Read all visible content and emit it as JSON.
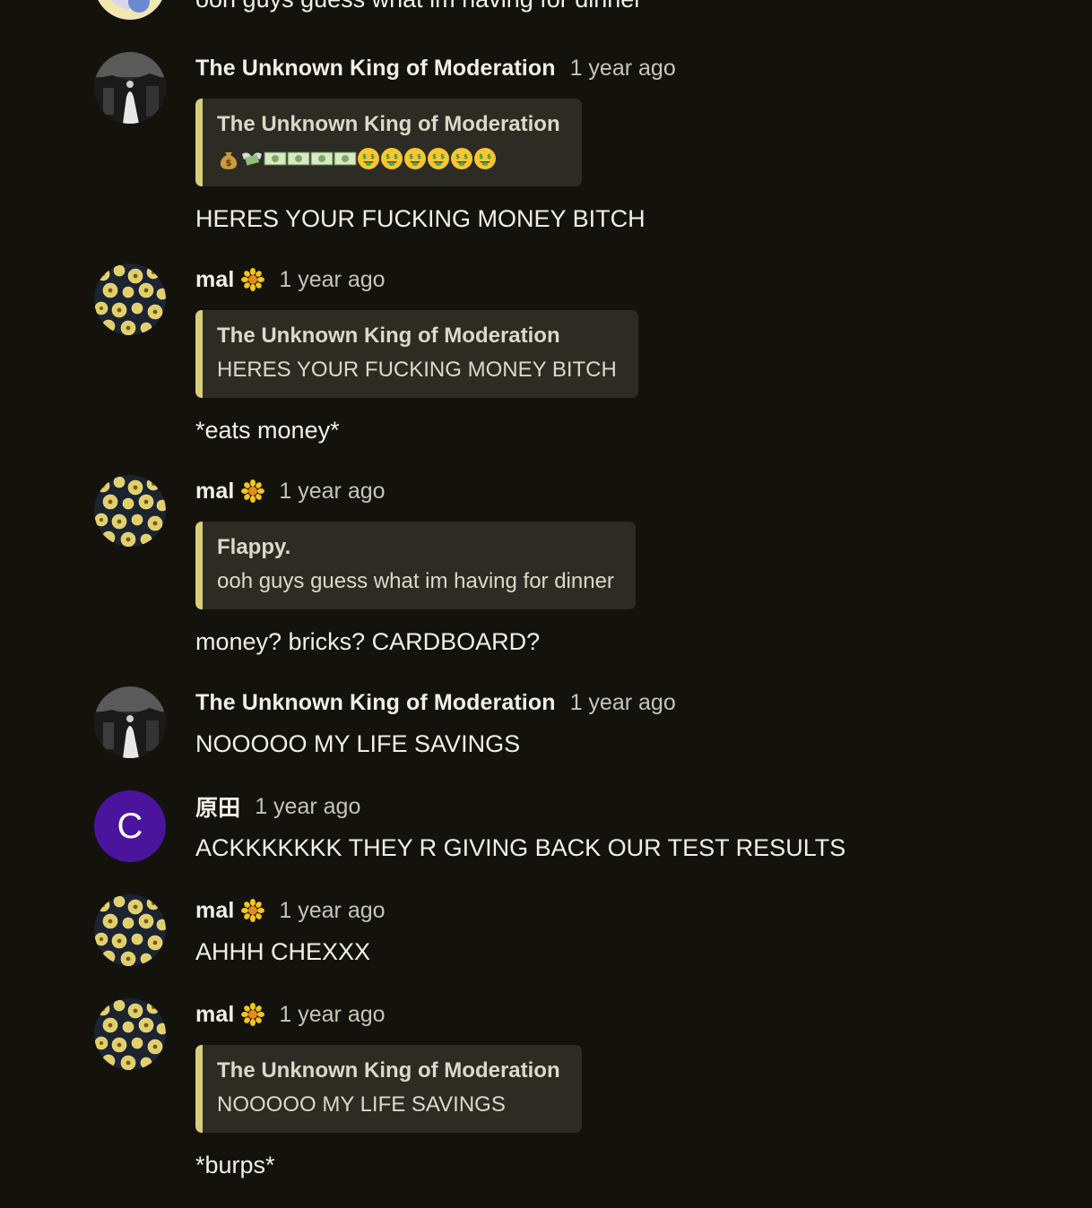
{
  "top_partial": {
    "text": "ooh guys guess what im having for dinner"
  },
  "messages": [
    {
      "author": "The Unknown King of Moderation",
      "time": "1 year ago",
      "avatar": "dark-photo",
      "quote_author": "The Unknown King of Moderation",
      "quote_emoji": [
        "money-bag",
        "money-wings",
        "banknotes",
        "banknotes",
        "banknotes",
        "banknotes",
        "money-face",
        "money-face",
        "money-face",
        "money-face",
        "money-face",
        "money-face"
      ],
      "text": "HERES YOUR FUCKING MONEY BITCH"
    },
    {
      "author": "mal",
      "badge": "sunflower-icon",
      "time": "1 year ago",
      "avatar": "flowers",
      "quote_author": "The Unknown King of Moderation",
      "quote_text": "HERES YOUR FUCKING MONEY BITCH",
      "text": "*eats money*"
    },
    {
      "author": "mal",
      "badge": "sunflower-icon",
      "time": "1 year ago",
      "avatar": "flowers",
      "quote_author": "Flappy.",
      "quote_text": "ooh guys guess what im having for dinner",
      "text": "money? bricks? CARDBOARD?"
    },
    {
      "author": "The Unknown King of Moderation",
      "time": "1 year ago",
      "avatar": "dark-photo",
      "text": "NOOOOO MY LIFE SAVINGS"
    },
    {
      "author": "原田",
      "time": "1 year ago",
      "avatar": "letter",
      "avatar_letter": "C",
      "avatar_color": "#4a149c",
      "text": "ACKKKKKKK THEY R GIVING BACK OUR TEST RESULTS"
    },
    {
      "author": "mal",
      "badge": "sunflower-icon",
      "time": "1 year ago",
      "avatar": "flowers",
      "text": "AHHH CHEXXX"
    },
    {
      "author": "mal",
      "badge": "sunflower-icon",
      "time": "1 year ago",
      "avatar": "flowers",
      "quote_author": "The Unknown King of Moderation",
      "quote_text": "NOOOOO MY LIFE SAVINGS",
      "text": "*burps*"
    }
  ]
}
